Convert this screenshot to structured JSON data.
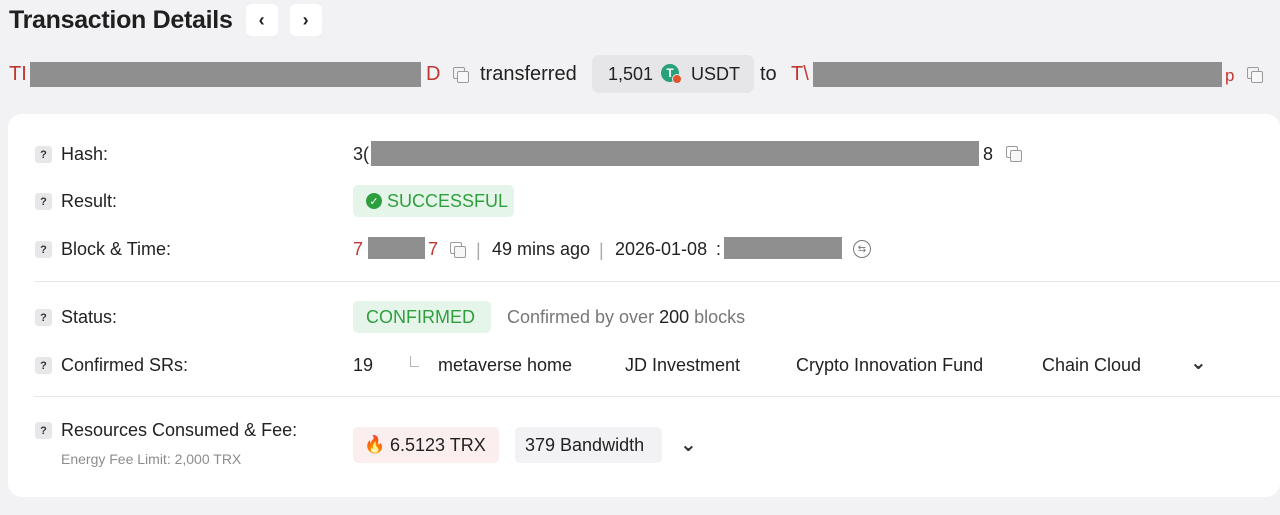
{
  "header": {
    "title": "Transaction Details",
    "prev_icon": "chevron-left-icon",
    "next_icon": "chevron-right-icon",
    "prev_glyph": "‹",
    "next_glyph": "›"
  },
  "summary": {
    "from_prefix": "TI",
    "from_suffix": "D",
    "verb": "transferred",
    "amount": "1,501",
    "token_symbol": "USDT",
    "token_icon": "tether-logo-icon",
    "token_glyph": "T",
    "connector": "to",
    "to_prefix": "T\\",
    "to_suffix": "p"
  },
  "details": {
    "hash": {
      "label": "Hash:",
      "prefix": "3(",
      "suffix": "8"
    },
    "result": {
      "label": "Result:",
      "value": "SUCCESSFUL",
      "check_glyph": "✓"
    },
    "block_time": {
      "label": "Block & Time:",
      "block_prefix": "7",
      "block_suffix": "7",
      "separator": "|",
      "age": "49 mins ago",
      "date": "2026-01-08",
      "date_tail": ":",
      "tz_glyph": "⇆"
    },
    "status": {
      "label": "Status:",
      "value": "CONFIRMED",
      "note_prefix": "Confirmed by over",
      "note_count": "200",
      "note_suffix": "blocks"
    },
    "confirmed_srs": {
      "label": "Confirmed SRs:",
      "count": "19",
      "items": [
        "metaverse home",
        "JD Investment",
        "Crypto Innovation Fund",
        "Chain Cloud"
      ],
      "expand_glyph": "⌄"
    },
    "resources": {
      "label": "Resources Consumed & Fee:",
      "sublabel": "Energy Fee Limit: 2,000 TRX",
      "trx_fee": "6.5123 TRX",
      "bandwidth": "379 Bandwidth",
      "flame_glyph": "🔥",
      "expand_glyph": "⌄"
    }
  },
  "colors": {
    "address_red": "#c23631",
    "success_green": "#2e9f3f",
    "success_bg": "#e6f5e9",
    "redaction_gray": "#8f8f8f"
  }
}
